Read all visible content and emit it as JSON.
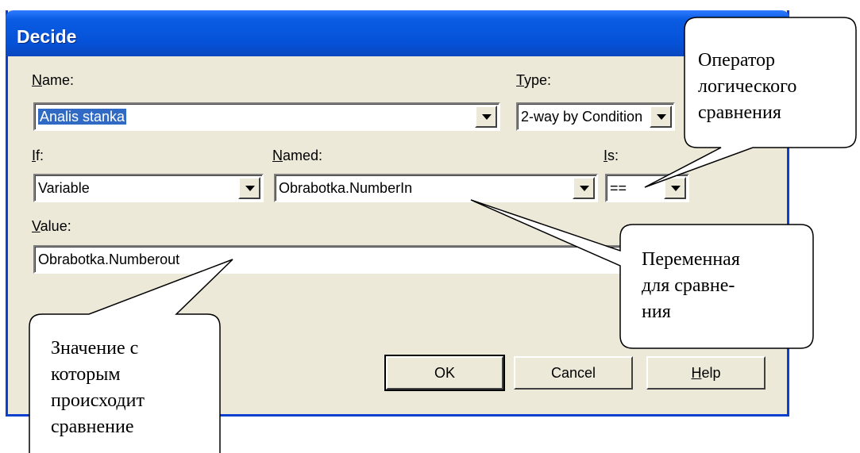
{
  "window": {
    "title": "Decide"
  },
  "labels": {
    "name": "Name:",
    "type": "Type:",
    "if": "If:",
    "named": "Named:",
    "is": "Is:",
    "value": "Value:"
  },
  "fields": {
    "name_value": "Analis stanka",
    "type_value": "2-way by Condition",
    "if_value": "Variable",
    "named_value": "Obrabotka.NumberIn",
    "is_value": "==",
    "value_value": "Obrabotka.Numberout"
  },
  "buttons": {
    "ok": "OK",
    "cancel": "Cancel",
    "help": "Help"
  },
  "callouts": {
    "operator": [
      "Оператор",
      "логического",
      "сравнения"
    ],
    "variable": [
      "Переменная",
      "для сравне-",
      "ния"
    ],
    "value": [
      "Значение с",
      "которым",
      "происходит",
      "сравнение"
    ]
  }
}
